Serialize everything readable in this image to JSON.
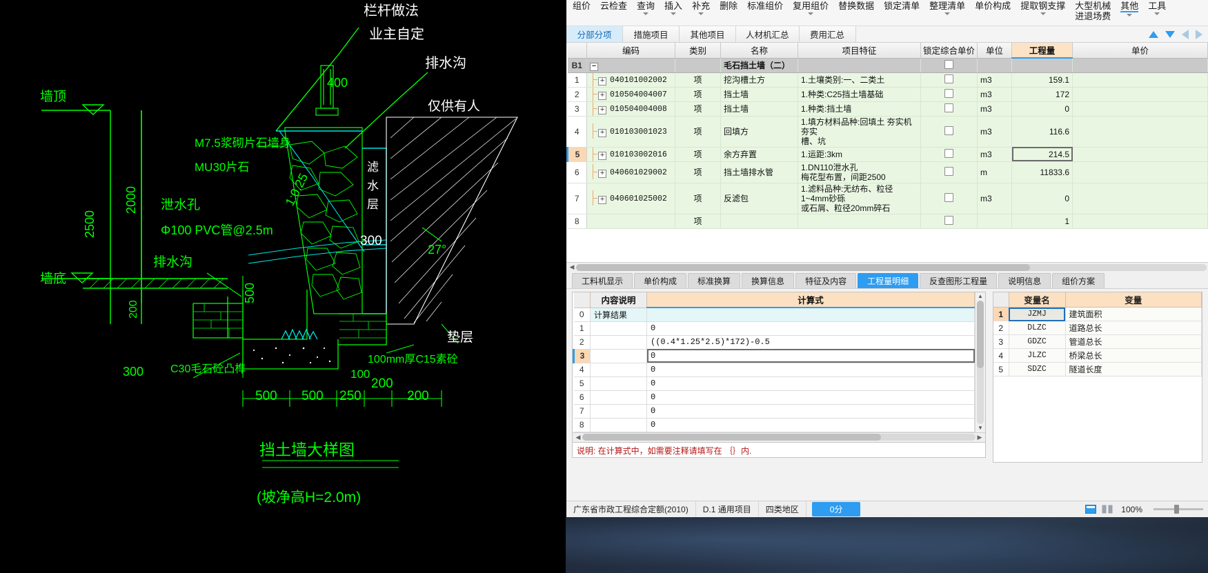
{
  "ribbon": {
    "items": [
      {
        "label": "组价",
        "caret": false
      },
      {
        "label": "云检查",
        "caret": false
      },
      {
        "label": "查询",
        "caret": true
      },
      {
        "label": "插入",
        "caret": true
      },
      {
        "label": "补充",
        "caret": true
      },
      {
        "label": "删除",
        "caret": false
      },
      {
        "label": "标准组价",
        "caret": false
      },
      {
        "label": "复用组价",
        "caret": true
      },
      {
        "label": "替换数据",
        "caret": false
      },
      {
        "label": "锁定清单",
        "caret": false
      },
      {
        "label": "整理清单",
        "caret": true
      },
      {
        "label": "单价构成",
        "caret": false
      },
      {
        "label": "提取钢支撑",
        "caret": true
      },
      {
        "label": "大型机械",
        "label2": "进退场费",
        "caret": false
      },
      {
        "label": "其他",
        "caret": true,
        "active": true
      },
      {
        "label": "工具",
        "caret": true
      }
    ]
  },
  "tabs": {
    "items": [
      "分部分项",
      "措施项目",
      "其他项目",
      "人材机汇总",
      "费用汇总"
    ],
    "active_index": 0
  },
  "nav_icons": {
    "up": "arrow-up-icon",
    "down": "arrow-down-icon",
    "left": "arrow-left-icon",
    "right": "arrow-right-icon"
  },
  "grid": {
    "headers": [
      "",
      "编码",
      "类别",
      "名称",
      "项目特征",
      "锁定综合单价",
      "单位",
      "工程量",
      "单价"
    ],
    "sorted_column": "工程量",
    "rows": [
      {
        "idx": "B1",
        "type": "group",
        "expander": "−",
        "code": "",
        "category": "",
        "name": "毛石挡土墙（二）",
        "feature": "",
        "lock": true,
        "unit": "",
        "qty": "",
        "price": ""
      },
      {
        "idx": "1",
        "type": "item",
        "expander": "+",
        "code": "040101002002",
        "category": "项",
        "name": "挖沟槽土方",
        "feature": "1.土壤类别:一、二类土",
        "lock": true,
        "unit": "m3",
        "qty": "159.1",
        "price": ""
      },
      {
        "idx": "2",
        "type": "item",
        "expander": "+",
        "code": "010504004007",
        "category": "项",
        "name": "挡土墙",
        "feature": "1.种类:C25挡土墙基础",
        "lock": true,
        "unit": "m3",
        "qty": "172",
        "price": ""
      },
      {
        "idx": "3",
        "type": "item",
        "expander": "+",
        "code": "010504004008",
        "category": "项",
        "name": "挡土墙",
        "feature": "1.种类:挡土墙",
        "lock": true,
        "unit": "m3",
        "qty": "0",
        "price": ""
      },
      {
        "idx": "4",
        "type": "item",
        "expander": "+",
        "code": "010103001023",
        "category": "项",
        "name": "回填方",
        "feature": "1.填方材料品种:回填土 夯实机夯实",
        "feature2": "槽、坑",
        "lock": true,
        "unit": "m3",
        "qty": "116.6",
        "price": ""
      },
      {
        "idx": "5",
        "type": "item",
        "selected": true,
        "expander": "+",
        "code": "010103002016",
        "category": "项",
        "name": "余方弃置",
        "feature": "1.运距:3km",
        "lock": true,
        "unit": "m3",
        "qty": "214.5",
        "qty_editing": true,
        "price": ""
      },
      {
        "idx": "6",
        "type": "item",
        "expander": "+",
        "code": "040601029002",
        "category": "项",
        "name": "挡土墙排水管",
        "feature": "1.DN110泄水孔",
        "feature2": "梅花型布置，间距2500",
        "lock": true,
        "unit": "m",
        "qty": "11833.6",
        "price": ""
      },
      {
        "idx": "7",
        "type": "item",
        "expander": "+",
        "code": "040601025002",
        "category": "项",
        "name": "反滤包",
        "feature": "1.滤料品种:无纺布、粒径1~4mm砂砾",
        "feature2": "或石屑、粒径20mm碎石",
        "lock": true,
        "unit": "m3",
        "qty": "0",
        "price": ""
      },
      {
        "idx": "8",
        "type": "item",
        "expander": "",
        "code": "",
        "category": "项",
        "name": "",
        "feature": "",
        "lock": true,
        "unit": "",
        "qty": "1",
        "price": ""
      }
    ]
  },
  "bottom_tabs": {
    "items": [
      "工料机显示",
      "单价构成",
      "标准换算",
      "换算信息",
      "特征及内容",
      "工程量明细",
      "反查图形工程量",
      "说明信息",
      "组价方案"
    ],
    "active_index": 5
  },
  "calc": {
    "headers": [
      "",
      "内容说明",
      "计算式"
    ],
    "rows": [
      {
        "no": "0",
        "desc": "计算结果",
        "formula": "",
        "highlight": true
      },
      {
        "no": "1",
        "desc": "",
        "formula": "0"
      },
      {
        "no": "2",
        "desc": "",
        "formula": "((0.4*1.25*2.5)*172)-0.5"
      },
      {
        "no": "3",
        "desc": "",
        "formula": "0",
        "selected": true,
        "editing": true
      },
      {
        "no": "4",
        "desc": "",
        "formula": "0"
      },
      {
        "no": "5",
        "desc": "",
        "formula": "0"
      },
      {
        "no": "6",
        "desc": "",
        "formula": "0"
      },
      {
        "no": "7",
        "desc": "",
        "formula": "0"
      },
      {
        "no": "8",
        "desc": "",
        "formula": "0"
      }
    ],
    "hint": "说明: 在计算式中，如需要注释请填写在 ｛｝内."
  },
  "variables": {
    "headers": [
      "",
      "变量名",
      "变量"
    ],
    "rows": [
      {
        "no": "1",
        "name": "JZMJ",
        "desc": "建筑面积",
        "selected": true
      },
      {
        "no": "2",
        "name": "DLZC",
        "desc": "道路总长"
      },
      {
        "no": "3",
        "name": "GDZC",
        "desc": "管道总长"
      },
      {
        "no": "4",
        "name": "JLZC",
        "desc": "桥梁总长"
      },
      {
        "no": "5",
        "name": "SDZC",
        "desc": "隧道长度"
      }
    ]
  },
  "statusbar": {
    "standard": "广东省市政工程综合定额(2010)",
    "project": "D.1 通用项目",
    "region": "四类地区",
    "badge": "0分",
    "zoom": "100%"
  },
  "drawing": {
    "title": "挡土墙大样图",
    "subtitle": "(坡净高H=2.0m)",
    "labels": {
      "railing1": "栏杆做法",
      "railing2": "业主自定",
      "drain_top": "排水沟",
      "owner_note": "仅供有人",
      "wall_top": "墙顶",
      "wall_bottom": "墙底",
      "mortar1": "M7.5浆砌片石墙身",
      "mortar2": "MU30片石",
      "weep_hole": "泄水孔",
      "weep_spec": "Φ100 PVC管@2.5m",
      "drain_ditch": "排水沟",
      "filter_layer": "滤水层",
      "cushion": "垫层",
      "concrete_key": "C30毛石砼凸榫",
      "plain_concrete": "100mm厚C15素砼",
      "dim_2500": "2500",
      "dim_2000": "2000",
      "dim_400": "400",
      "dim_300_filter": "300",
      "dim_500_left": "500",
      "dim_300_bottom": "300",
      "dim_200": "200",
      "slope": "1:0.25",
      "angle": "27°",
      "dims_bottom": [
        "500",
        "500",
        "250",
        "200"
      ],
      "dims_bottom2": [
        "100",
        "200"
      ],
      "dim_500_v": "500",
      "dim_200_v": "200"
    }
  }
}
